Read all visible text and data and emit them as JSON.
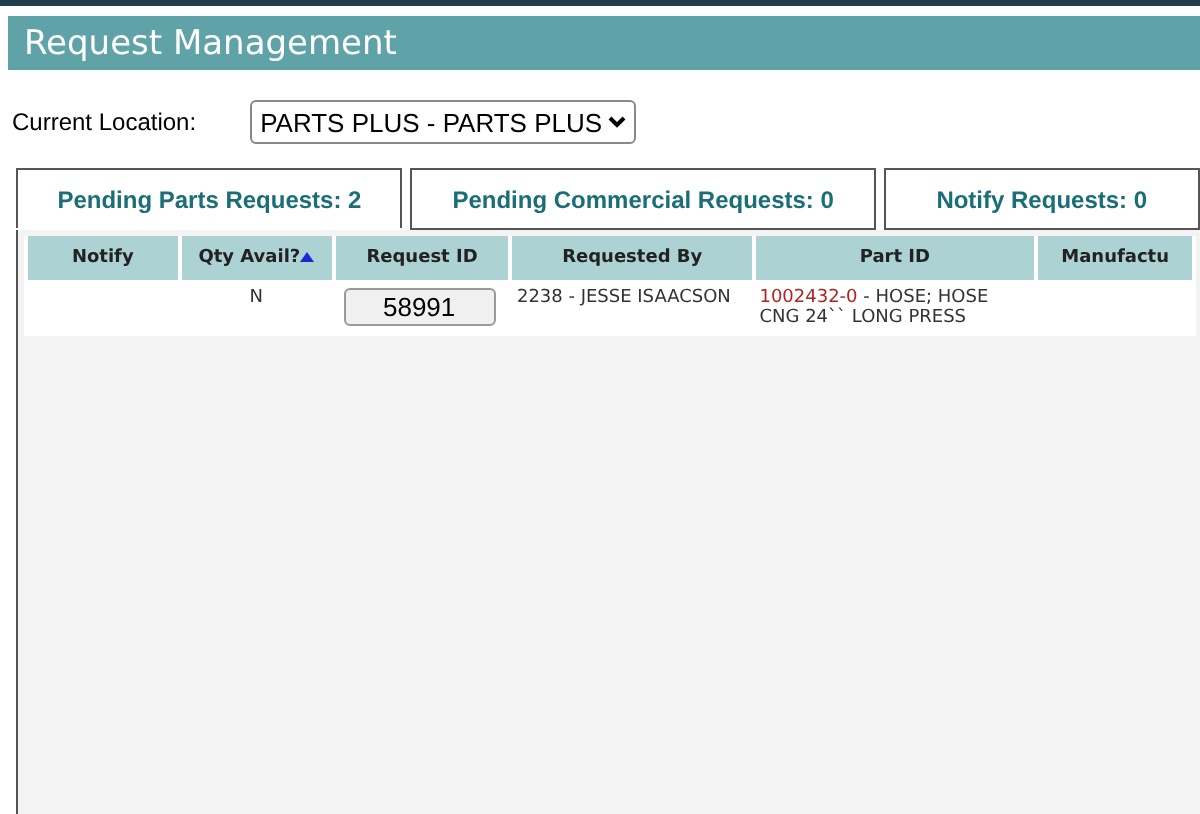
{
  "header": {
    "title": "Request Management"
  },
  "location": {
    "label": "Current Location:",
    "value": "PARTS PLUS - PARTS PLUS"
  },
  "tabs": [
    {
      "label": "Pending Parts Requests: 2",
      "selected": true
    },
    {
      "label": "Pending Commercial Requests: 0",
      "selected": false
    },
    {
      "label": "Notify Requests: 0",
      "selected": false
    }
  ],
  "table": {
    "columns": [
      {
        "label": "Notify",
        "sorted": false
      },
      {
        "label": "Qty Avail?",
        "sorted": true
      },
      {
        "label": "Request ID",
        "sorted": false
      },
      {
        "label": "Requested By",
        "sorted": false
      },
      {
        "label": "Part ID",
        "sorted": false
      },
      {
        "label": "Manufactu",
        "sorted": false
      }
    ],
    "rows": [
      {
        "qty_avail": "N",
        "request_id": "58991",
        "requested_by": "2238 - JESSE ISAACSON",
        "part_number": "1002432-0",
        "part_description": " - HOSE; HOSE CNG 24`` LONG PRESS"
      }
    ]
  }
}
